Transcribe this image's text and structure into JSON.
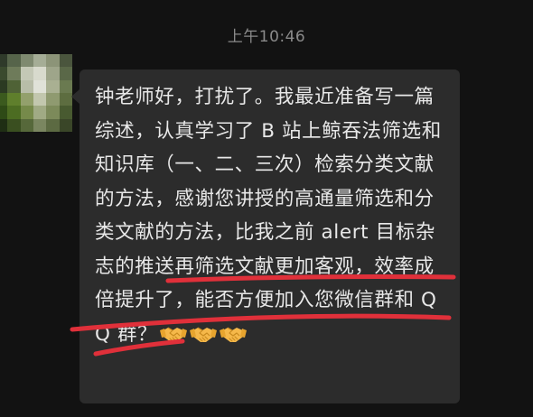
{
  "chat": {
    "timestamp": "上午10:46",
    "message": {
      "text": "钟老师好，打扰了。我最近准备写一篇综述，认真学习了 B 站上鲸吞法筛选和知识库（一、二、三次）检索分类文献的方法，感谢您讲授的高通量筛选和分类文献的方法，比我之前 alert 目标杂志的推送再筛选文献更加客观，效率成倍提升了，能否方便加入您微信群和 QQ 群？",
      "emojis": [
        "handshake-emoji",
        "handshake-emoji",
        "handshake-emoji"
      ]
    },
    "annotation": {
      "color": "#e0303a",
      "marks": [
        "underline-1",
        "underline-2",
        "underline-3"
      ]
    }
  },
  "colors": {
    "background": "#121212",
    "bubble": "#2c2c2c",
    "text": "#e8e8e8",
    "timestamp": "#8a8a8a"
  }
}
